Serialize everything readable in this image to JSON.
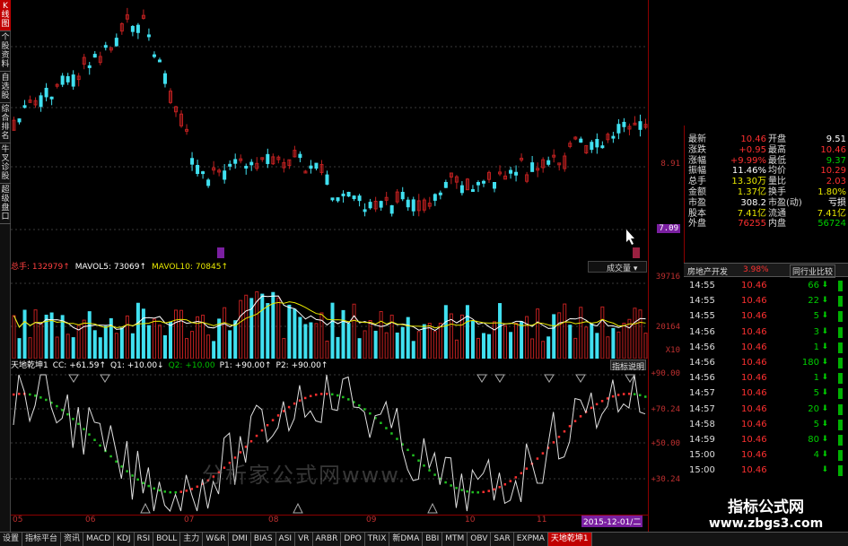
{
  "left_strip": [
    "K线图",
    "个股资料",
    "自选股",
    "综合排名",
    "牛叉诊股",
    "超级盘口"
  ],
  "price_axis": {
    "labels": [
      {
        "text": "8.91",
        "value": 8.91
      },
      {
        "text": "7.09",
        "value": 7.09,
        "highlight": true
      }
    ]
  },
  "volume": {
    "header": [
      {
        "text": "总手: 132979↑",
        "color": "#ff4040"
      },
      {
        "text": "MAVOL5: 73069↑",
        "color": "#ffffff"
      },
      {
        "text": "MAVOL10: 70845↑",
        "color": "#e8e800"
      }
    ],
    "dropdown": "成交量",
    "axis": [
      "39716",
      "20164",
      "X10"
    ]
  },
  "indicator": {
    "header": [
      {
        "text": "天地乾坤1",
        "color": "#ffffff"
      },
      {
        "text": "CC: +61.59↑",
        "color": "#ffffff"
      },
      {
        "text": "Q1: +10.00↓",
        "color": "#ffffff"
      },
      {
        "text": "Q2: +10.00",
        "color": "#00c000"
      },
      {
        "text": "P1: +90.00↑",
        "color": "#ffffff"
      },
      {
        "text": "P2: +90.00↑",
        "color": "#ffffff"
      }
    ],
    "button": "指标说明",
    "axis": [
      "+90.00",
      "+70.24",
      "+50.00",
      "+30.24"
    ]
  },
  "date_axis": {
    "labels": [
      "05",
      "06",
      "07",
      "08",
      "09",
      "10",
      "11"
    ],
    "cursor": "2015-12-01/二"
  },
  "bottom_tabs": [
    "设置",
    "指标平台",
    "资讯",
    "MACD",
    "KDJ",
    "RSI",
    "BOLL",
    "主力",
    "W&R",
    "DMI",
    "BIAS",
    "ASI",
    "VR",
    "ARBR",
    "DPO",
    "TRIX",
    "新DMA",
    "BBI",
    "MTM",
    "OBV",
    "SAR",
    "EXPMA",
    "天地乾坤1"
  ],
  "bottom_tabs_active": "天地乾坤1",
  "quote": {
    "rows": [
      {
        "l1": "最新",
        "v1": "10.46",
        "c1": "red",
        "l2": "开盘",
        "v2": "9.51",
        "c2": "white"
      },
      {
        "l1": "涨跌",
        "v1": "+0.95",
        "c1": "red",
        "l2": "最高",
        "v2": "10.46",
        "c2": "red"
      },
      {
        "l1": "涨幅",
        "v1": "+9.99%",
        "c1": "red",
        "l2": "最低",
        "v2": "9.37",
        "c2": "green"
      },
      {
        "l1": "振幅",
        "v1": "11.46%",
        "c1": "white",
        "l2": "均价",
        "v2": "10.29",
        "c2": "red"
      },
      {
        "l1": "总手",
        "v1": "13.30万",
        "c1": "yellow",
        "l2": "量比",
        "v2": "2.03",
        "c2": "red"
      },
      {
        "l1": "金额",
        "v1": "1.37亿",
        "c1": "yellow",
        "l2": "换手",
        "v2": "1.80%",
        "c2": "yellow"
      },
      {
        "l1": "市盈",
        "v1": "308.2",
        "c1": "white",
        "l2": "市盈(动)",
        "v2": "亏损",
        "c2": "white"
      },
      {
        "l1": "股本",
        "v1": "7.41亿",
        "c1": "yellow",
        "l2": "流通",
        "v2": "7.41亿",
        "c2": "yellow"
      },
      {
        "l1": "外盘",
        "v1": "76255",
        "c1": "red",
        "l2": "内盘",
        "v2": "56724",
        "c2": "green"
      }
    ]
  },
  "sector": {
    "name": "房地产开发",
    "change": "3.98%",
    "compare": "同行业比较"
  },
  "trades": [
    {
      "time": "14:55",
      "price": "10.46",
      "vol": "66",
      "dir": "down"
    },
    {
      "time": "14:55",
      "price": "10.46",
      "vol": "22",
      "dir": "down"
    },
    {
      "time": "14:55",
      "price": "10.46",
      "vol": "5",
      "dir": "down"
    },
    {
      "time": "14:56",
      "price": "10.46",
      "vol": "3",
      "dir": "down"
    },
    {
      "time": "14:56",
      "price": "10.46",
      "vol": "1",
      "dir": "down"
    },
    {
      "time": "14:56",
      "price": "10.46",
      "vol": "180",
      "dir": "down"
    },
    {
      "time": "14:56",
      "price": "10.46",
      "vol": "1",
      "dir": "down"
    },
    {
      "time": "14:57",
      "price": "10.46",
      "vol": "5",
      "dir": "down"
    },
    {
      "time": "14:57",
      "price": "10.46",
      "vol": "20",
      "dir": "down"
    },
    {
      "time": "14:58",
      "price": "10.46",
      "vol": "5",
      "dir": "down"
    },
    {
      "time": "14:59",
      "price": "10.46",
      "vol": "80",
      "dir": "down"
    },
    {
      "time": "15:00",
      "price": "10.46",
      "vol": "4",
      "dir": "down"
    },
    {
      "time": "15:00",
      "price": "10.46",
      "vol": "",
      "dir": "down"
    }
  ],
  "site": {
    "title": "指标公式网",
    "url": "www.zbgs3.com"
  },
  "chart_watermark": "分析家公式网www.",
  "colors": {
    "up": "#ff3030",
    "down": "#40e0f0",
    "up_candle": "#c02020",
    "axis": "#8b0000"
  }
}
